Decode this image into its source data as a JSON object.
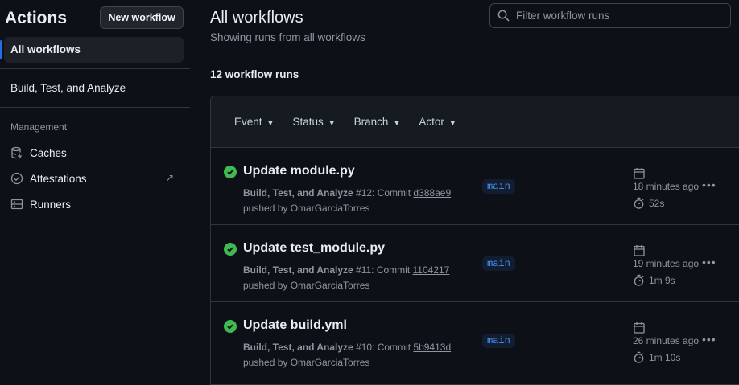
{
  "sidebar": {
    "title": "Actions",
    "new_workflow": "New workflow",
    "all_workflows": "All workflows",
    "workflow": "Build, Test, and Analyze",
    "management_label": "Management",
    "items": [
      {
        "label": "Caches",
        "icon": "database-icon"
      },
      {
        "label": "Attestations",
        "icon": "verified-icon"
      },
      {
        "label": "Runners",
        "icon": "server-icon"
      }
    ]
  },
  "main": {
    "title": "All workflows",
    "subtitle": "Showing runs from all workflows",
    "search_placeholder": "Filter workflow runs",
    "count": "12 workflow runs",
    "filters": [
      "Event",
      "Status",
      "Branch",
      "Actor"
    ],
    "runs": [
      {
        "title": "Update module.py",
        "workflow": "Build, Test, and Analyze",
        "run": "#12: Commit",
        "sha": "d388ae9",
        "pushed": "pushed by OmarGarciaTorres",
        "branch": "main",
        "time": "18 minutes ago",
        "duration": "52s",
        "status": "success"
      },
      {
        "title": "Update test_module.py",
        "workflow": "Build, Test, and Analyze",
        "run": "#11: Commit",
        "sha": "1104217",
        "pushed": "pushed by OmarGarciaTorres",
        "branch": "main",
        "time": "19 minutes ago",
        "duration": "1m 9s",
        "status": "success"
      },
      {
        "title": "Update build.yml",
        "workflow": "Build, Test, and Analyze",
        "run": "#10: Commit",
        "sha": "5b9413d",
        "pushed": "pushed by OmarGarciaTorres",
        "branch": "main",
        "time": "26 minutes ago",
        "duration": "1m 10s",
        "status": "success"
      }
    ]
  },
  "colors": {
    "success": "#3fb950",
    "accent": "#1f6feb",
    "link": "#4493f8"
  }
}
